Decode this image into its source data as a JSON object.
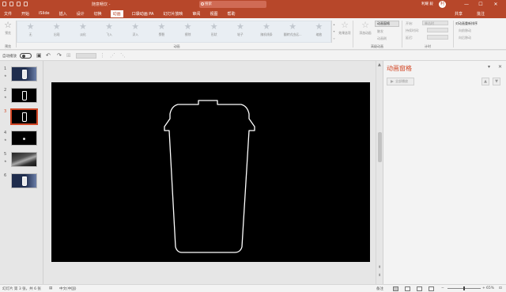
{
  "window": {
    "doc_title": "随意畅饮 -",
    "search_placeholder": "搜索",
    "user_name": "利耀 毅",
    "user_initial": "利",
    "min_glyph": "—",
    "max_glyph": "☐",
    "close_glyph": "✕"
  },
  "tabs": [
    "文件",
    "开始",
    "iSlide",
    "插入",
    "设计",
    "切换",
    "动画",
    "口袋动画 PA",
    "幻灯片放映",
    "审阅",
    "视图",
    "帮助"
  ],
  "active_tab": "动画",
  "share_label": "共享",
  "comment_label": "批注",
  "ribbon": {
    "preview_label": "预览",
    "preview_group": "预览",
    "gallery_items": [
      "无",
      "出现",
      "淡化",
      "飞入",
      "浮入",
      "劈裂",
      "擦除",
      "形状",
      "轮子",
      "随机线条",
      "翻转式由远...",
      "缩放"
    ],
    "effect_options_label": "效果选项",
    "animation_group": "动画",
    "add_animation_label": "添加动画",
    "anim_pane_label": "动画窗格",
    "trigger_label": "触发",
    "painter_label": "动画刷",
    "advanced_group": "高级动画",
    "start_label": "开始:",
    "start_value": "单击时",
    "duration_label": "持续时间:",
    "delay_label": "延迟:",
    "timing_group": "计时",
    "reorder_label": "对动画重新排序",
    "move_earlier": "向前移动",
    "move_later": "向后移动"
  },
  "qabar": {
    "autoplay_label": "自动播放"
  },
  "slides": [
    {
      "num": "1",
      "star": "★",
      "kind": "coffee-brand"
    },
    {
      "num": "2",
      "star": "★",
      "kind": "cup-outline"
    },
    {
      "num": "3",
      "star": "",
      "kind": "cup-outline"
    },
    {
      "num": "4",
      "star": "★",
      "kind": "dark-dot"
    },
    {
      "num": "5",
      "star": "★",
      "kind": "photo"
    },
    {
      "num": "6",
      "star": "",
      "kind": "coffee-brand"
    }
  ],
  "selected_slide": 3,
  "anim_pane": {
    "title": "动画窗格",
    "play_label": "全部播放",
    "up_glyph": "▲",
    "down_glyph": "▼"
  },
  "status": {
    "slide_info": "幻灯片 第 3 张，共 6 张",
    "language": "中文(中国)",
    "notes_label": "备注",
    "zoom_label": "65%"
  },
  "colors": {
    "accent": "#b7472a",
    "slide_bg": "#000000",
    "outline": "#ffffff",
    "pane_title": "#d24726"
  }
}
